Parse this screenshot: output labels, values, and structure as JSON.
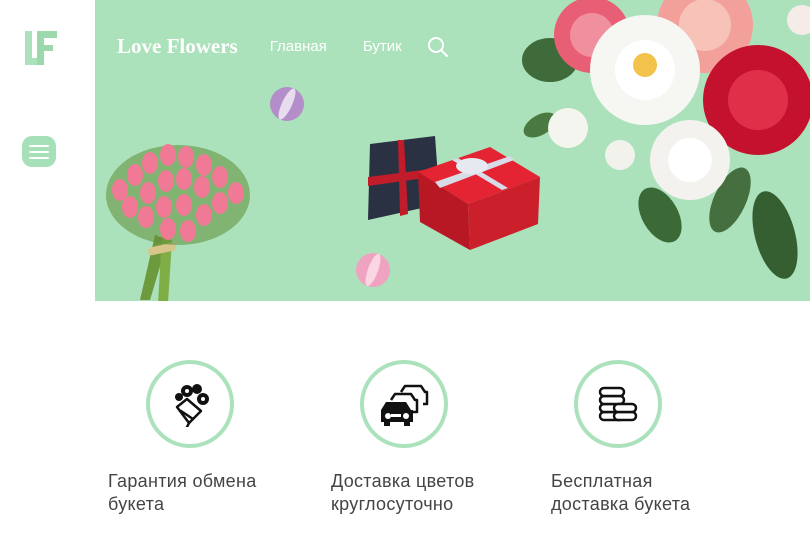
{
  "logo": {
    "text": "LF"
  },
  "nav": {
    "brand": "Love Flowers",
    "links": [
      "Главная",
      "Бутик"
    ]
  },
  "colors": {
    "accent": "#abe2bb",
    "menu": "#a6e0b9",
    "text": "#444444"
  },
  "icons": {
    "menu": "hamburger-icon",
    "search": "search-icon",
    "bouquet": "bouquet-icon",
    "cars": "cars-icon",
    "coins": "coins-icon"
  },
  "features": [
    {
      "line1": "Гарантия обмена",
      "line2": "букета"
    },
    {
      "line1": "Доставка цветов",
      "line2": "круглосуточно"
    },
    {
      "line1": "Бесплатная",
      "line2": "доставка букета"
    }
  ]
}
